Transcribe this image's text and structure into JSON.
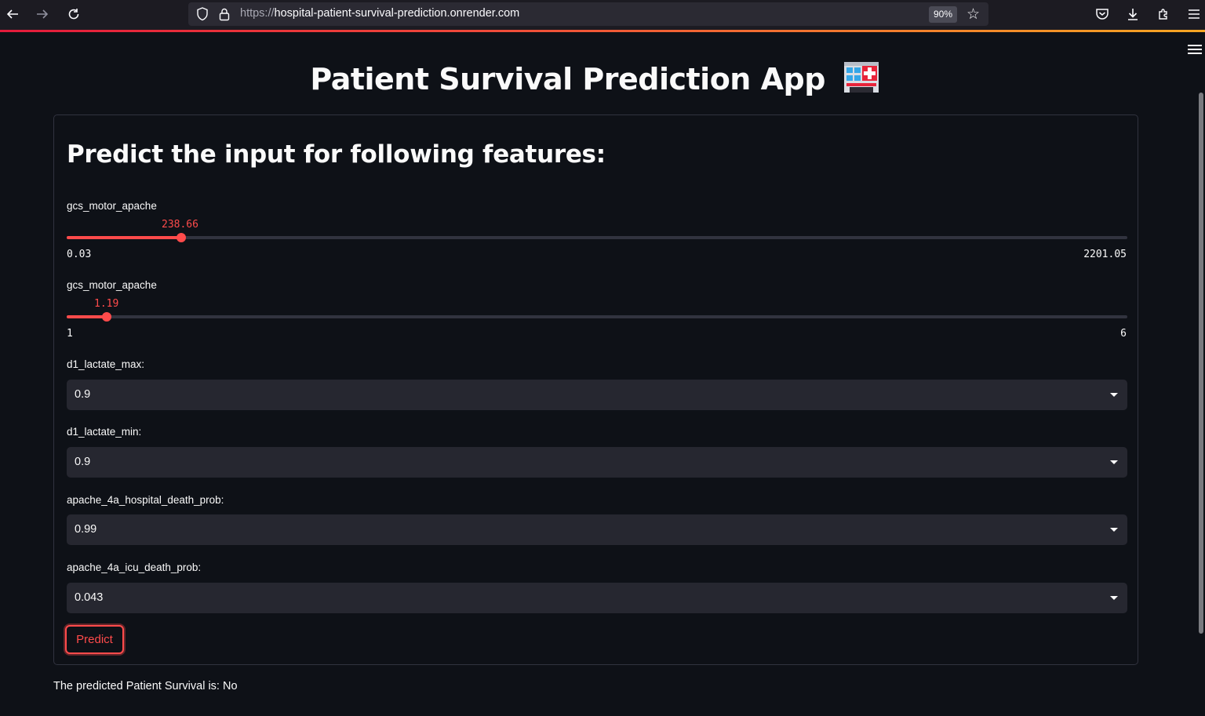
{
  "browser": {
    "url_protocol": "https://",
    "url_host": "hospital-patient-survival-prediction.onrender.com",
    "zoom": "90%"
  },
  "app": {
    "title": "Patient Survival Prediction App",
    "title_icon": "hospital-icon",
    "form_title": "Predict the input for following features:",
    "sliders": [
      {
        "label": "gcs_motor_apache",
        "value": "238.66",
        "min": "0.03",
        "max": "2201.05",
        "fraction": 0.108
      },
      {
        "label": "gcs_motor_apache",
        "value": "1.19",
        "min": "1",
        "max": "6",
        "fraction": 0.038
      }
    ],
    "selects": [
      {
        "label": "d1_lactate_max:",
        "value": "0.9"
      },
      {
        "label": "d1_lactate_min:",
        "value": "0.9"
      },
      {
        "label": "apache_4a_hospital_death_prob:",
        "value": "0.99"
      },
      {
        "label": "apache_4a_icu_death_prob:",
        "value": "0.043"
      }
    ],
    "predict_label": "Predict",
    "result_text": "The predicted Patient Survival is: No"
  },
  "colors": {
    "accent": "#ff4b4b",
    "background": "#0e1117",
    "input_bg": "#262730"
  }
}
